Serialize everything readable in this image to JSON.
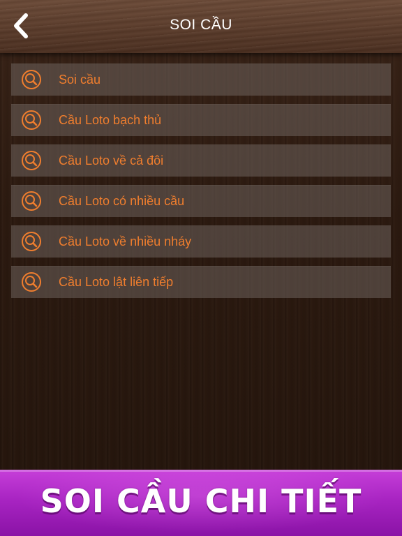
{
  "header": {
    "title": "SOI CẦU",
    "back_icon": "chevron-left-icon"
  },
  "menu": {
    "icon": "search-icon",
    "accent_color": "#f07e2e",
    "items": [
      {
        "label": "Soi cầu"
      },
      {
        "label": "Cầu Loto bạch thủ"
      },
      {
        "label": "Cầu Loto về cả đôi"
      },
      {
        "label": "Cầu Loto có nhiều cầu"
      },
      {
        "label": "Cầu Loto về nhiều nháy"
      },
      {
        "label": "Cầu Loto lật liên tiếp"
      }
    ]
  },
  "banner": {
    "text": "SOI CẦU CHI TIẾT",
    "color": "#a824c2"
  }
}
